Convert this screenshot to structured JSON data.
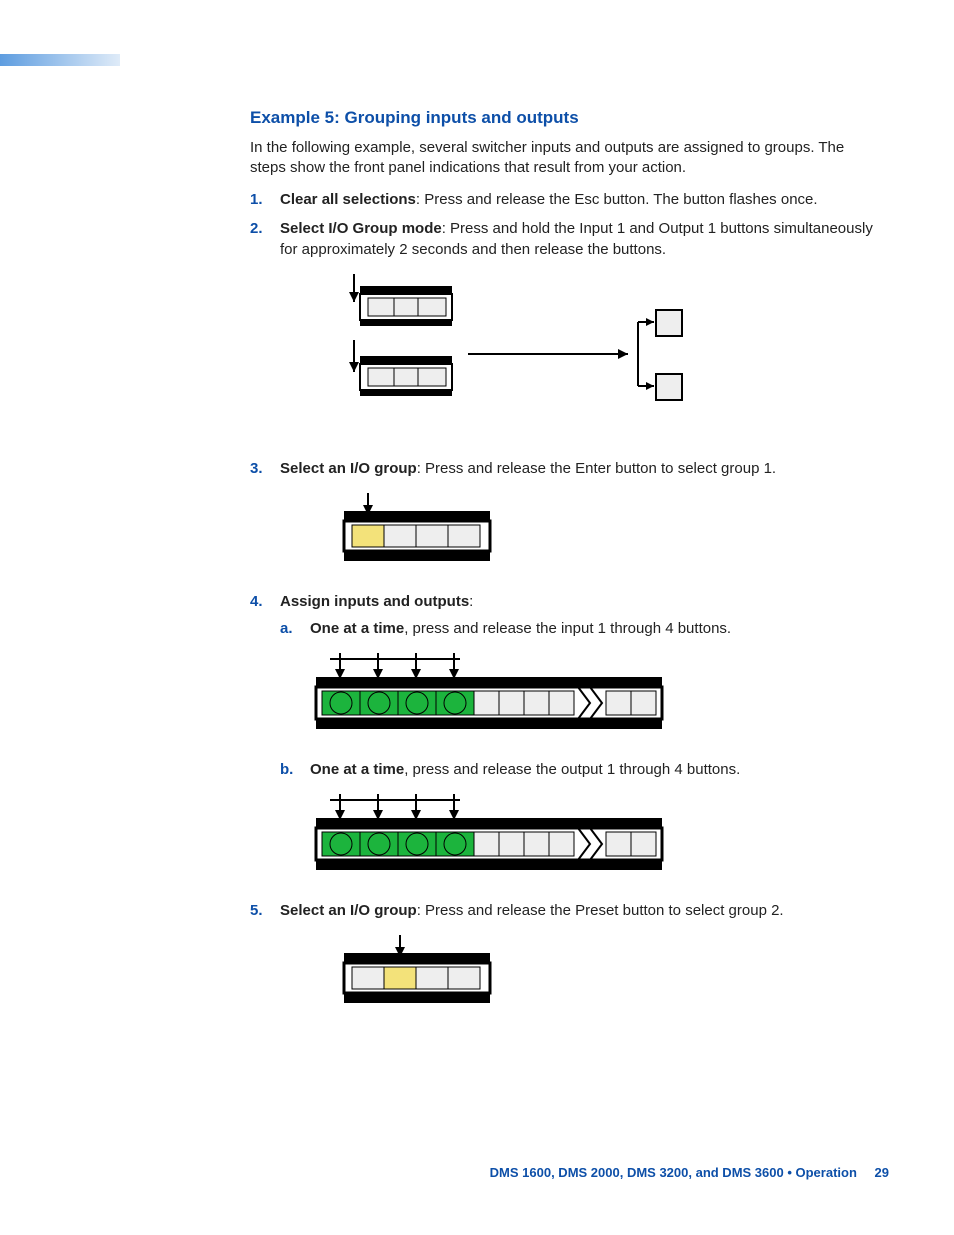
{
  "title": "Example 5: Grouping inputs and outputs",
  "intro": "In the following example, several switcher inputs and outputs are assigned to groups. The steps show the front panel indications that result from your action.",
  "steps": {
    "s1_num": "1.",
    "s1_b": "Clear all selections",
    "s1_t": ": Press and release the Esc button. The button flashes once.",
    "s2_num": "2.",
    "s2_b": "Select I/O Group mode",
    "s2_t": ": Press and hold the Input 1 and Output 1 buttons simultaneously for approximately 2 seconds and then release the buttons.",
    "s3_num": "3.",
    "s3_b": "Select an I/O group",
    "s3_t": ": Press and release the Enter button to select group 1.",
    "s4_num": "4.",
    "s4_b": "Assign inputs and outputs",
    "s4_t": ":",
    "s4a_let": "a.",
    "s4a_b": "One at a time",
    "s4a_t": ", press and release the input 1 through 4 buttons.",
    "s4b_let": "b.",
    "s4b_b": "One at a time",
    "s4b_t": ", press and release the output 1 through 4 buttons.",
    "s5_num": "5.",
    "s5_b": "Select an I/O group",
    "s5_t": ": Press and release the Preset button to select group 2."
  },
  "footer": {
    "text": "DMS 1600, DMS 2000, DMS 3200, and DMS 3600 • Operation",
    "page": "29"
  }
}
